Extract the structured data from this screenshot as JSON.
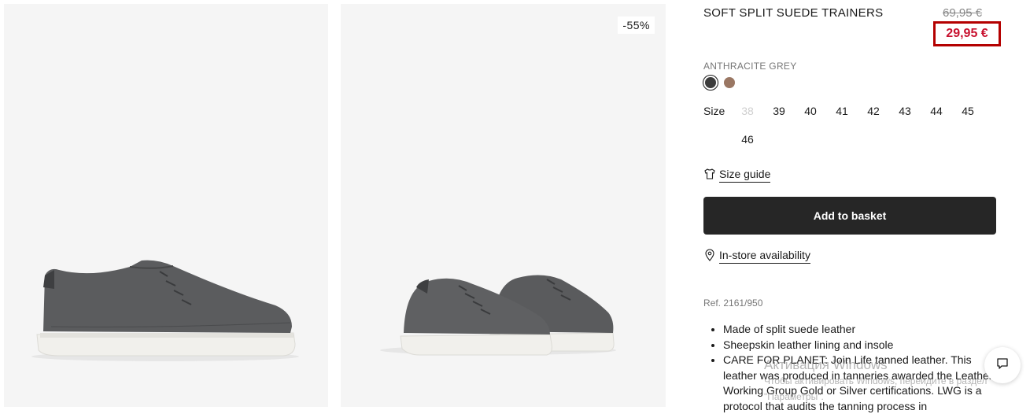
{
  "gallery": {
    "discount_badge": "-55%"
  },
  "product": {
    "title": "SOFT SPLIT SUEDE TRAINERS",
    "old_price": "69,95 €",
    "new_price": "29,95 €",
    "color_name": "ANTHRACITE GREY",
    "swatches": [
      {
        "name": "anthracite-grey",
        "color": "#3c3c3c",
        "selected": true
      },
      {
        "name": "brown",
        "color": "#9a7763",
        "selected": false
      }
    ],
    "size_label": "Size",
    "sizes": [
      {
        "value": "38",
        "available": false
      },
      {
        "value": "39",
        "available": true
      },
      {
        "value": "40",
        "available": true
      },
      {
        "value": "41",
        "available": true
      },
      {
        "value": "42",
        "available": true
      },
      {
        "value": "43",
        "available": true
      },
      {
        "value": "44",
        "available": true
      },
      {
        "value": "45",
        "available": true
      },
      {
        "value": "46",
        "available": true
      }
    ],
    "size_guide": "Size guide",
    "add_to_basket": "Add to basket",
    "in_store": "In-store availability",
    "ref": "Ref. 2161/950",
    "details": [
      "Made of split suede leather",
      "Sheepskin leather lining and insole",
      "CARE FOR PLANET: Join Life tanned leather. This leather was produced in tanneries awarded the Leather Working Group Gold or Silver certifications. LWG is a protocol that audits the tanning process in"
    ]
  },
  "os_watermark": {
    "title": "Активация Windows",
    "subtitle": "Чтобы активировать Windows, перейдите в раздел \"Параметры\"."
  },
  "colors": {
    "sale_red": "#c8102e",
    "highlight_border": "#b40000",
    "button_dark": "#262626"
  }
}
